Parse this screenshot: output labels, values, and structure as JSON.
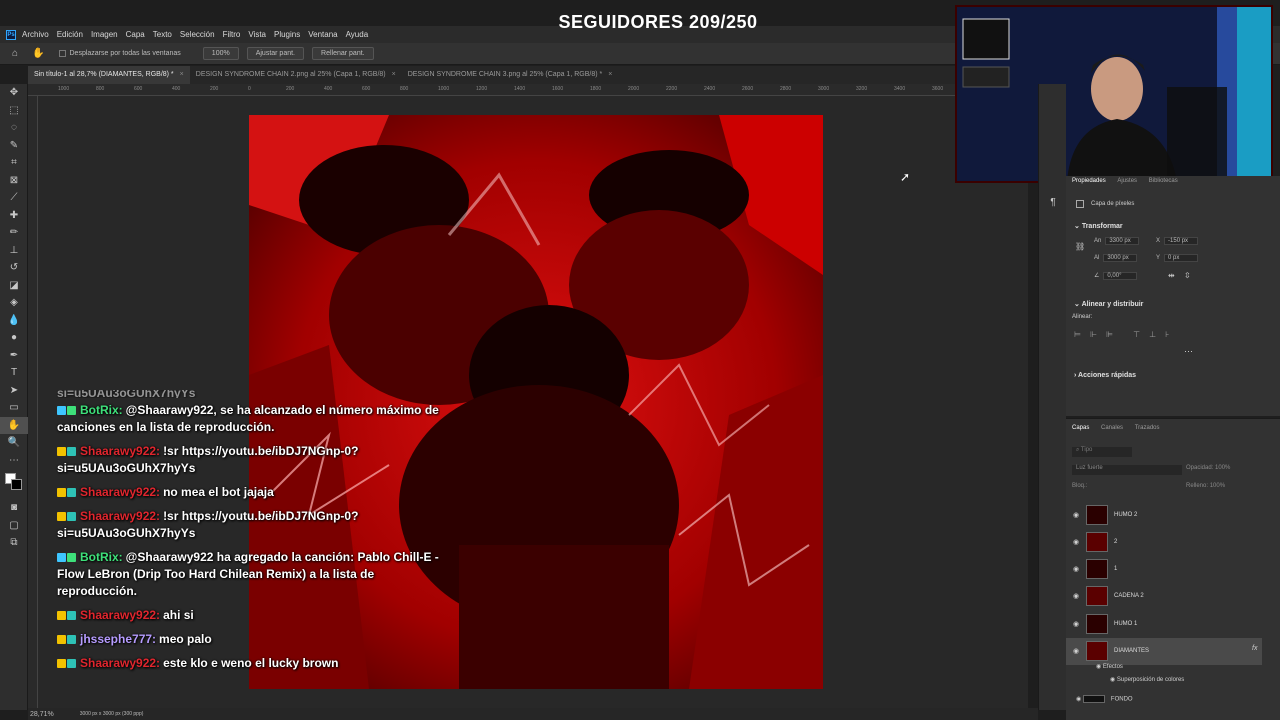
{
  "overlay": {
    "followers_text": "SEGUIDORES 209/250"
  },
  "app": {
    "logo": "Ps"
  },
  "menu": [
    "Archivo",
    "Edición",
    "Imagen",
    "Capa",
    "Texto",
    "Selección",
    "Filtro",
    "Vista",
    "Plugins",
    "Ventana",
    "Ayuda"
  ],
  "options": {
    "scroll_all_label": "Desplazarse por todas las ventanas",
    "zoom_value": "100%",
    "fit_label": "Ajustar pant.",
    "fill_label": "Rellenar pant."
  },
  "tabs": [
    {
      "label": "Sin título-1 al 28,7% (DIAMANTES, RGB/8) *",
      "active": true
    },
    {
      "label": "DESIGN SYNDROME CHAIN 2.png al 25% (Capa 1, RGB/8)",
      "active": false
    },
    {
      "label": "DESIGN SYNDROME CHAIN 3.png al 25% (Capa 1, RGB/8) *",
      "active": false
    }
  ],
  "ruler_ticks": [
    "1000",
    "800",
    "600",
    "400",
    "200",
    "0",
    "200",
    "400",
    "600",
    "800",
    "1000",
    "1200",
    "1400",
    "1600",
    "1800",
    "2000",
    "2200",
    "2400",
    "2600",
    "2800",
    "3000",
    "3200",
    "3400",
    "3600"
  ],
  "status": {
    "zoom": "28,71%",
    "doc_size": "3000 px x 3000 px (300 ppp)"
  },
  "chat": {
    "partial_top": "si=u5UAu3oGUhX7hyYs",
    "messages": [
      {
        "user": "BotRix:",
        "user_color": "#3ee07a",
        "text": "@Shaarawy922, se ha alcanzado el número máximo de canciones en la lista de reproducción."
      },
      {
        "user": "Shaarawy922:",
        "user_color": "#e0262e",
        "text": "!sr https://youtu.be/ibDJ7NGnp-0?si=u5UAu3oGUhX7hyYs"
      },
      {
        "user": "Shaarawy922:",
        "user_color": "#e0262e",
        "text": "no mea el bot jajaja"
      },
      {
        "user": "Shaarawy922:",
        "user_color": "#e0262e",
        "text": "!sr https://youtu.be/ibDJ7NGnp-0?si=u5UAu3oGUhX7hyYs"
      },
      {
        "user": "BotRix:",
        "user_color": "#3ee07a",
        "text": "@Shaarawy922 ha agregado la canción: Pablo Chill-E - Flow LeBron (Drip Too Hard Chilean Remix) a la lista de reproducción."
      },
      {
        "user": "Shaarawy922:",
        "user_color": "#e0262e",
        "text": "ahi si"
      },
      {
        "user": "jhssephe777:",
        "user_color": "#b69cff",
        "text": "meo palo"
      },
      {
        "user": "Shaarawy922:",
        "user_color": "#e0262e",
        "text": "este klo e weno el lucky brown"
      }
    ]
  },
  "properties": {
    "tabs": [
      "Propiedades",
      "Ajustes",
      "Bibliotecas"
    ],
    "layer_type": "Capa de píxeles",
    "transform_title": "Transformar",
    "an_label": "An",
    "an_value": "3300 px",
    "x_label": "X",
    "x_value": "-150 px",
    "al_label": "Al",
    "al_value": "3000 px",
    "y_label": "Y",
    "y_value": "0 px",
    "angle_value": "0,00°",
    "align_title": "Alinear y distribuir",
    "align_label": "Alinear:",
    "quick_title": "Acciones rápidas"
  },
  "layers": {
    "tabs": [
      "Capas",
      "Canales",
      "Trazados"
    ],
    "search_placeholder": "Tipo",
    "blend_mode": "Luz fuerte",
    "opacity_label": "Opacidad:",
    "opacity_value": "100%",
    "lock_label": "Bloq.:",
    "fill_label": "Relleno:",
    "fill_value": "100%",
    "items": [
      {
        "name": "HUMO 2",
        "selected": false
      },
      {
        "name": "2",
        "selected": false
      },
      {
        "name": "1",
        "selected": false
      },
      {
        "name": "CADENA 2",
        "selected": false
      },
      {
        "name": "HUMO 1",
        "selected": false
      },
      {
        "name": "DIAMANTES",
        "selected": true
      }
    ],
    "effects_label": "Efectos",
    "effect_item": "Superposición de colores",
    "fx": "fx",
    "last_layer": "FONDO"
  },
  "colors": {
    "accent_red": "#c8000a",
    "ps_blue": "#31a8ff"
  }
}
